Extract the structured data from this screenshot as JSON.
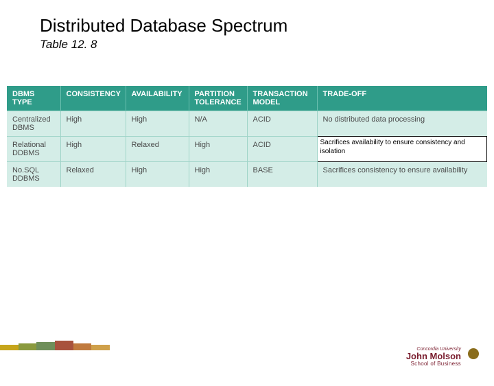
{
  "title": "Distributed Database Spectrum",
  "subtitle": "Table 12. 8",
  "headers": {
    "c0": "DBMS TYPE",
    "c1": "CONSISTENCY",
    "c2": "AVAILABILITY",
    "c3": "PARTITION TOLERANCE",
    "c4": "TRANSACTION MODEL",
    "c5": "TRADE-OFF"
  },
  "rows": [
    {
      "type": "Centralized DBMS",
      "consistency": "High",
      "availability": "High",
      "partition": "N/A",
      "transaction": "ACID",
      "tradeoff": "No distributed data processing"
    },
    {
      "type": "Relational DDBMS",
      "consistency": "High",
      "availability": "Relaxed",
      "partition": "High",
      "transaction": "ACID",
      "tradeoff": "Sacrifices availability to ensure consistency and isolation"
    },
    {
      "type": "No.SQL DDBMS",
      "consistency": "Relaxed",
      "availability": "High",
      "partition": "High",
      "transaction": "BASE",
      "tradeoff": "Sacrifices consistency to ensure availability"
    }
  ],
  "logo": {
    "tiny": "Concordia University",
    "name": "John Molson",
    "sub": "School of Business"
  },
  "chart_data": {
    "type": "table",
    "title": "Distributed Database Spectrum — Table 12.8",
    "columns": [
      "DBMS TYPE",
      "CONSISTENCY",
      "AVAILABILITY",
      "PARTITION TOLERANCE",
      "TRANSACTION MODEL",
      "TRADE-OFF"
    ],
    "rows": [
      [
        "Centralized DBMS",
        "High",
        "High",
        "N/A",
        "ACID",
        "No distributed data processing"
      ],
      [
        "Relational DDBMS",
        "High",
        "Relaxed",
        "High",
        "ACID",
        "Sacrifices availability to ensure consistency and isolation"
      ],
      [
        "No.SQL DDBMS",
        "Relaxed",
        "High",
        "High",
        "BASE",
        "Sacrifices consistency to ensure availability"
      ]
    ]
  }
}
